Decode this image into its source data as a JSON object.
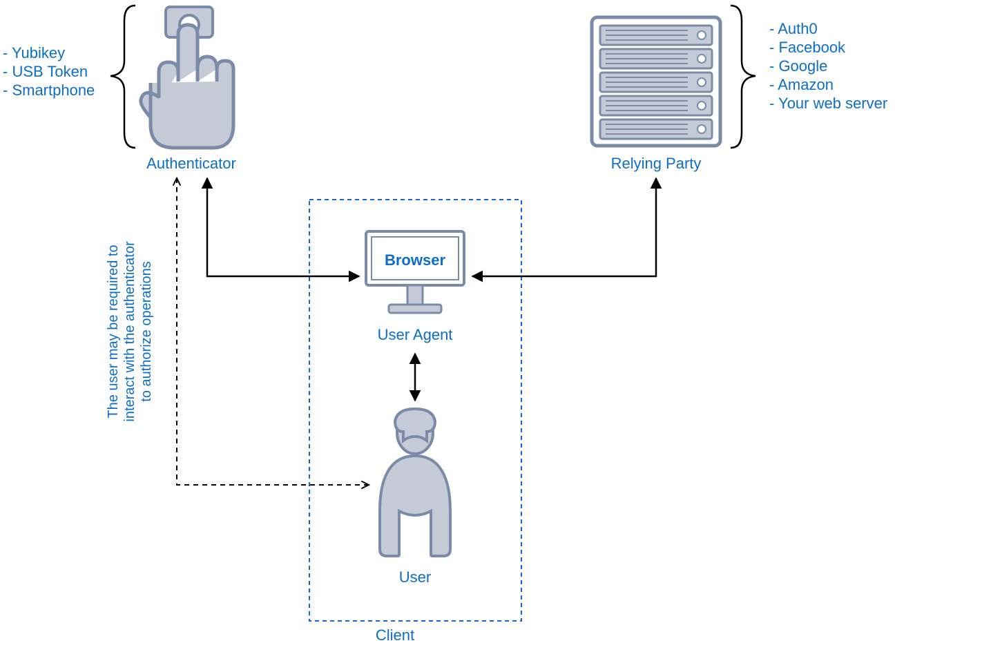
{
  "labels": {
    "authenticator": "Authenticator",
    "relying_party": "Relying Party",
    "user_agent": "User Agent",
    "browser": "Browser",
    "user": "User",
    "client": "Client"
  },
  "authenticator_examples": [
    "- Yubikey",
    "- USB Token",
    "- Smartphone"
  ],
  "relying_party_examples": [
    "- Auth0",
    "- Facebook",
    "- Google",
    "- Amazon",
    "- Your web server"
  ],
  "note_lines": [
    "The user may be required to",
    "interact with the authenticator",
    "to authorize operations"
  ]
}
